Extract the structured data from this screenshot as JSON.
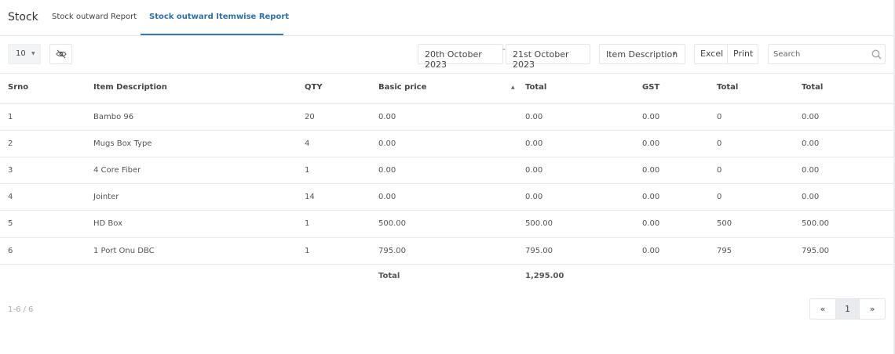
{
  "header": {
    "app_title": "Stock",
    "tabs": [
      {
        "label": "Stock outward Report"
      },
      {
        "label": "Stock outward Itemwise Report"
      }
    ]
  },
  "toolbar": {
    "page_length": "10",
    "date_from": "20th October 2023",
    "date_separator": "-",
    "date_to": "21st October 2023",
    "item_filter": "Item Description",
    "excel_label": "Excel",
    "print_label": "Print",
    "search_placeholder": "Search"
  },
  "table": {
    "columns": [
      "Srno",
      "Item Description",
      "QTY",
      "Basic price",
      "Total",
      "GST",
      "Total",
      "Total"
    ],
    "rows": [
      [
        "1",
        "Bambo 96",
        "20",
        "0.00",
        "0.00",
        "0.00",
        "0",
        "0.00"
      ],
      [
        "2",
        "Mugs Box Type",
        "4",
        "0.00",
        "0.00",
        "0.00",
        "0",
        "0.00"
      ],
      [
        "3",
        "4 Core Fiber",
        "1",
        "0.00",
        "0.00",
        "0.00",
        "0",
        "0.00"
      ],
      [
        "4",
        "Jointer",
        "14",
        "0.00",
        "0.00",
        "0.00",
        "0",
        "0.00"
      ],
      [
        "5",
        "HD Box",
        "1",
        "500.00",
        "500.00",
        "0.00",
        "500",
        "500.00"
      ],
      [
        "6",
        "1 Port Onu DBC",
        "1",
        "795.00",
        "795.00",
        "0.00",
        "795",
        "795.00"
      ]
    ],
    "footer": {
      "label": "Total",
      "value": "1,295.00"
    }
  },
  "pagination": {
    "range_info": "1-6 / 6",
    "prev": "«",
    "current": "1",
    "next": "»"
  },
  "colors": {
    "accent": "#3a78b5",
    "border": "#e6e9ed"
  },
  "icons": {
    "visibility_toggle": "eye-off-icon",
    "search": "search-icon",
    "sort": "sort-asc-icon"
  }
}
